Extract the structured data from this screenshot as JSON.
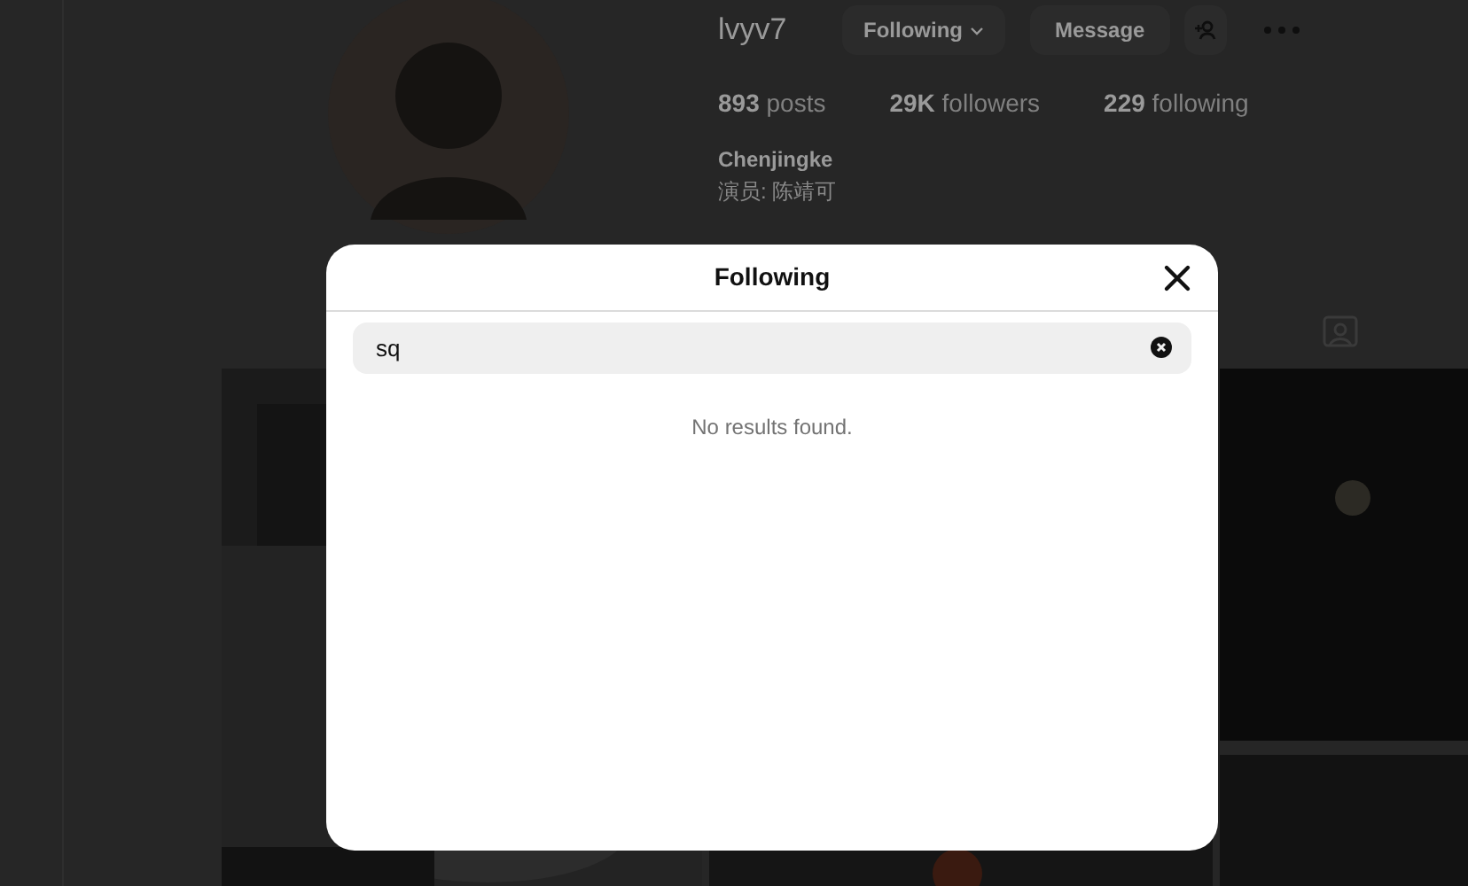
{
  "profile": {
    "username": "lvyv7",
    "follow_button": "Following",
    "message_button": "Message",
    "stats": [
      {
        "count": "893",
        "label": "posts"
      },
      {
        "count": "29K",
        "label": "followers"
      },
      {
        "count": "229",
        "label": "following"
      }
    ],
    "full_name": "Chenjingke",
    "bio": "演员: 陈靖可"
  },
  "dialog": {
    "title": "Following",
    "search": {
      "value": "sq"
    },
    "empty_message": "No results found."
  }
}
